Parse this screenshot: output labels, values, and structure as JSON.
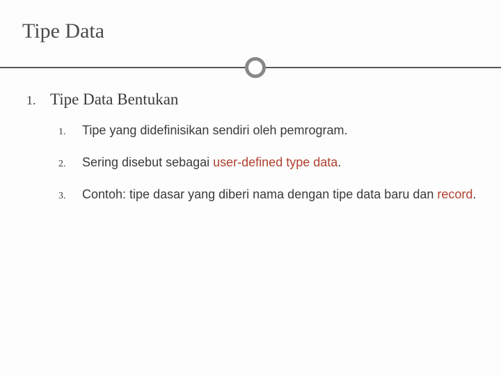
{
  "slide": {
    "title": "Tipe Data",
    "main_marker": "1.",
    "main_text": "Tipe Data Bentukan",
    "items": [
      {
        "marker": "1.",
        "prefix": "Tipe yang didefinisikan sendiri oleh pemrogram.",
        "highlight": "",
        "suffix": ""
      },
      {
        "marker": "2.",
        "prefix": "Sering disebut sebagai ",
        "highlight": "user-defined type data",
        "suffix": "."
      },
      {
        "marker": "3.",
        "prefix": "Contoh: tipe dasar yang diberi nama dengan tipe data baru dan ",
        "highlight": "record",
        "suffix": "."
      }
    ]
  }
}
